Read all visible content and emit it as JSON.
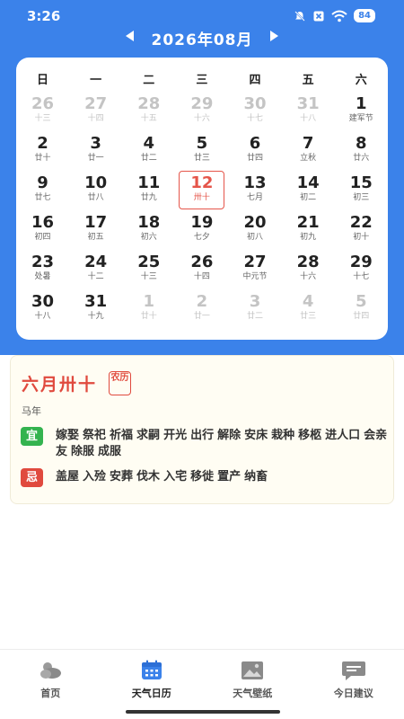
{
  "status": {
    "time": "3:26",
    "battery": "84"
  },
  "header": {
    "month_label": "2026年08月"
  },
  "weekdays": [
    "日",
    "一",
    "二",
    "三",
    "四",
    "五",
    "六"
  ],
  "calendar": {
    "days": [
      {
        "d": "26",
        "l": "十三",
        "other": true
      },
      {
        "d": "27",
        "l": "十四",
        "other": true
      },
      {
        "d": "28",
        "l": "十五",
        "other": true
      },
      {
        "d": "29",
        "l": "十六",
        "other": true
      },
      {
        "d": "30",
        "l": "十七",
        "other": true
      },
      {
        "d": "31",
        "l": "十八",
        "other": true
      },
      {
        "d": "1",
        "l": "建军节"
      },
      {
        "d": "2",
        "l": "廿十"
      },
      {
        "d": "3",
        "l": "廿一"
      },
      {
        "d": "4",
        "l": "廿二"
      },
      {
        "d": "5",
        "l": "廿三"
      },
      {
        "d": "6",
        "l": "廿四"
      },
      {
        "d": "7",
        "l": "立秋"
      },
      {
        "d": "8",
        "l": "廿六"
      },
      {
        "d": "9",
        "l": "廿七"
      },
      {
        "d": "10",
        "l": "廿八"
      },
      {
        "d": "11",
        "l": "廿九"
      },
      {
        "d": "12",
        "l": "卅十",
        "today": true
      },
      {
        "d": "13",
        "l": "七月"
      },
      {
        "d": "14",
        "l": "初二"
      },
      {
        "d": "15",
        "l": "初三"
      },
      {
        "d": "16",
        "l": "初四"
      },
      {
        "d": "17",
        "l": "初五"
      },
      {
        "d": "18",
        "l": "初六"
      },
      {
        "d": "19",
        "l": "七夕"
      },
      {
        "d": "20",
        "l": "初八"
      },
      {
        "d": "21",
        "l": "初九"
      },
      {
        "d": "22",
        "l": "初十"
      },
      {
        "d": "23",
        "l": "处暑"
      },
      {
        "d": "24",
        "l": "十二"
      },
      {
        "d": "25",
        "l": "十三"
      },
      {
        "d": "26",
        "l": "十四"
      },
      {
        "d": "27",
        "l": "中元节"
      },
      {
        "d": "28",
        "l": "十六"
      },
      {
        "d": "29",
        "l": "十七"
      },
      {
        "d": "30",
        "l": "十八"
      },
      {
        "d": "31",
        "l": "十九"
      },
      {
        "d": "1",
        "l": "廿十",
        "other": true
      },
      {
        "d": "2",
        "l": "廿一",
        "other": true
      },
      {
        "d": "3",
        "l": "廿二",
        "other": true
      },
      {
        "d": "4",
        "l": "廿三",
        "other": true
      },
      {
        "d": "5",
        "l": "廿四",
        "other": true
      }
    ]
  },
  "info": {
    "lunar_date": "六月卅十",
    "badge": "农历",
    "year": "马年",
    "yi_label": "宜",
    "yi_items": [
      "嫁娶",
      "祭祀",
      "祈福",
      "求嗣",
      "开光",
      "出行",
      "解除",
      "安床",
      "栽种",
      "移柩",
      "进人口",
      "会亲友",
      "除服",
      "成服"
    ],
    "ji_label": "忌",
    "ji_items": [
      "盖屋",
      "入殓",
      "安葬",
      "伐木",
      "入宅",
      "移徙",
      "置产",
      "纳畜"
    ]
  },
  "tabs": [
    {
      "label": "首页",
      "icon": "cloud-sun-icon"
    },
    {
      "label": "天气日历",
      "icon": "calendar-icon",
      "active": true
    },
    {
      "label": "天气壁纸",
      "icon": "image-icon"
    },
    {
      "label": "今日建议",
      "icon": "message-icon"
    }
  ],
  "colors": {
    "primary": "#3b82ea",
    "accent_red": "#e04a3e",
    "good_green": "#34b34f"
  }
}
